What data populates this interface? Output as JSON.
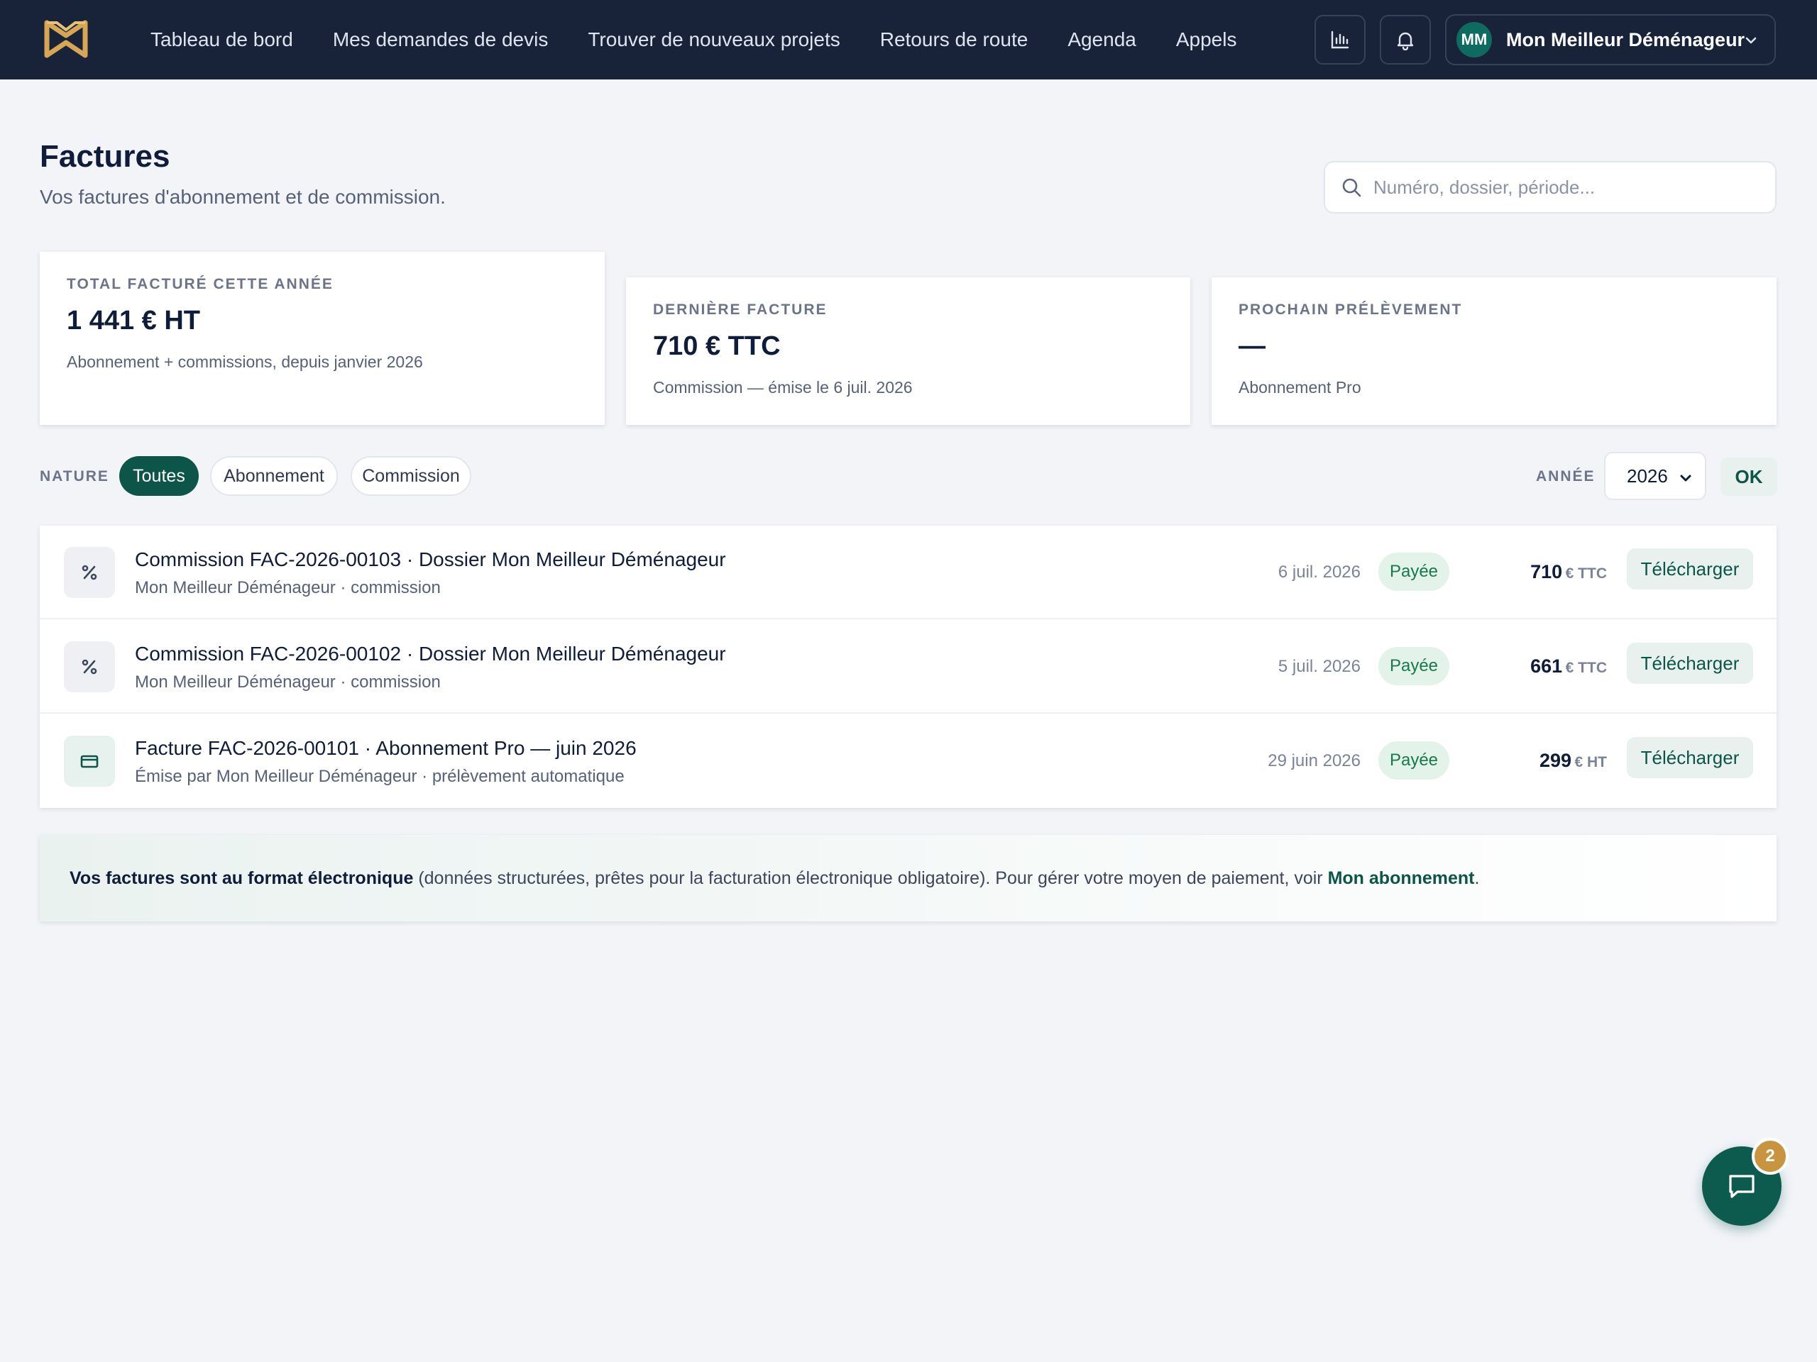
{
  "nav": {
    "links": [
      "Tableau de bord",
      "Mes demandes de devis",
      "Trouver de nouveaux projets",
      "Retours de route",
      "Agenda",
      "Appels"
    ],
    "account": {
      "initials": "MM",
      "name": "Mon Meilleur Déménageur"
    },
    "icons": [
      "stats-icon",
      "bell-icon"
    ]
  },
  "header": {
    "title": "Factures",
    "subtitle": "Vos factures d'abonnement et de commission.",
    "search_placeholder": "Numéro, dossier, période..."
  },
  "stats": [
    {
      "label": "TOTAL FACTURÉ CETTE ANNÉE",
      "value": "1 441 € HT",
      "note": "Abonnement + commissions, depuis janvier 2026"
    },
    {
      "label": "DERNIÈRE FACTURE",
      "value": "710 € TTC",
      "note": "Commission — émise le 6 juil. 2026"
    },
    {
      "label": "PROCHAIN PRÉLÈVEMENT",
      "value": "—",
      "note": "Abonnement Pro"
    }
  ],
  "filters": {
    "nature_label": "NATURE",
    "chips": [
      "Toutes",
      "Abonnement",
      "Commission"
    ],
    "active_chip": "Toutes",
    "year_label": "ANNÉE",
    "year_value": "2026",
    "ok_label": "OK"
  },
  "invoices": [
    {
      "icon": "percent-icon",
      "title": "Commission FAC-2026-00103 · Dossier Mon Meilleur Déménageur",
      "subtitle": "Mon Meilleur Déménageur · commission",
      "date": "6 juil. 2026",
      "status": "Payée",
      "amount": "710",
      "unit": "€ TTC",
      "action": "Télécharger"
    },
    {
      "icon": "percent-icon",
      "title": "Commission FAC-2026-00102 · Dossier Mon Meilleur Déménageur",
      "subtitle": "Mon Meilleur Déménageur · commission",
      "date": "5 juil. 2026",
      "status": "Payée",
      "amount": "661",
      "unit": "€ TTC",
      "action": "Télécharger"
    },
    {
      "icon": "credit-card-icon",
      "title": "Facture FAC-2026-00101 · Abonnement Pro — juin 2026",
      "subtitle": "Émise par Mon Meilleur Déménageur · prélèvement automatique",
      "date": "29 juin 2026",
      "status": "Payée",
      "amount": "299",
      "unit": "€ HT",
      "action": "Télécharger"
    }
  ],
  "info": {
    "bold": "Vos factures sont au format électronique",
    "text": " (données structurées, prêtes pour la facturation électronique obligatoire). Pour gérer votre moyen de paiement, voir ",
    "link": "Mon abonnement",
    "end": "."
  },
  "chat": {
    "badge_count": "2",
    "icon": "chat-icon"
  },
  "colors": {
    "navbar": "#18233a",
    "accent": "#0d5549",
    "badge_paid": "#177a4a",
    "logo": "#d6a654",
    "chat_badge": "#c8953e"
  }
}
